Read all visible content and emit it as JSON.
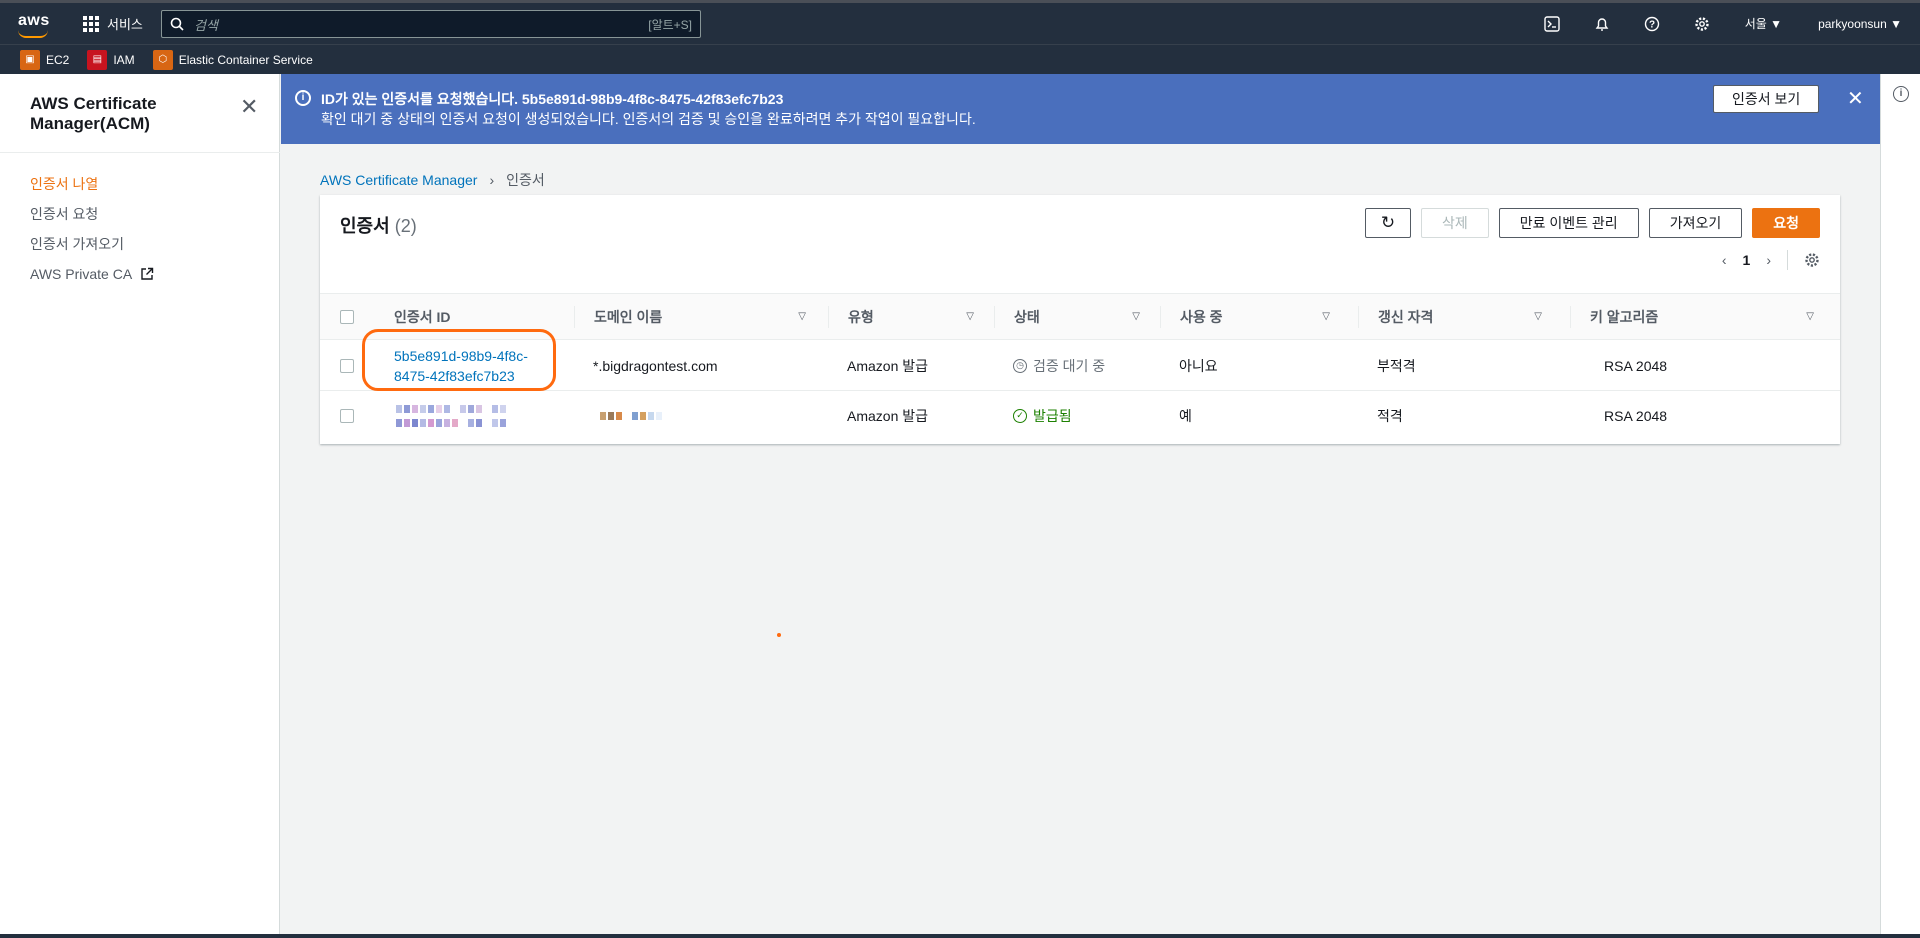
{
  "topnav": {
    "logo": "aws",
    "services_label": "서비스",
    "search_placeholder": "검색",
    "search_shortcut": "[알트+S]",
    "region": "서울 ▼",
    "user": "parkyoonsun ▼",
    "icons": [
      "cloudshell-icon",
      "bell-icon",
      "help-icon",
      "settings-icon"
    ]
  },
  "favorites": [
    {
      "label": "EC2",
      "color": "#d86613"
    },
    {
      "label": "IAM",
      "color": "#c7131f"
    },
    {
      "label": "Elastic Container Service",
      "color": "#d86613"
    }
  ],
  "sidebar": {
    "title": "AWS Certificate Manager(ACM)",
    "items": [
      {
        "label": "인증서 나열",
        "active": true
      },
      {
        "label": "인증서 요청"
      },
      {
        "label": "인증서 가져오기"
      },
      {
        "label": "AWS Private CA",
        "external": true
      }
    ]
  },
  "flash": {
    "title": "ID가 있는 인증서를 요청했습니다. 5b5e891d-98b9-4f8c-8475-42f83efc7b23",
    "message": "확인 대기 중 상태의 인증서 요청이 생성되었습니다. 인증서의 검증 및 승인을 완료하려면 추가 작업이 필요합니다.",
    "button": "인증서 보기"
  },
  "breadcrumb": {
    "root": "AWS Certificate Manager",
    "sep": "›",
    "current": "인증서"
  },
  "panel": {
    "title": "인증서",
    "count": "(2)",
    "buttons": {
      "delete": "삭제",
      "expiry": "만료 이벤트 관리",
      "import": "가져오기",
      "request": "요청"
    },
    "page": "1"
  },
  "table": {
    "headers": [
      "인증서 ID",
      "도메인 이름",
      "유형",
      "상태",
      "사용 중",
      "갱신 자격",
      "키 알고리즘"
    ],
    "rows": [
      {
        "id_line1": "5b5e891d-98b9-4f8c-",
        "id_line2": "8475-42f83efc7b23",
        "domain": "*.bigdragontest.com",
        "type": "Amazon 발급",
        "status": "검증 대기 중",
        "in_use": "아니요",
        "renewal": "부적격",
        "algo": "RSA 2048"
      },
      {
        "id_line1": "",
        "id_line2": "",
        "domain": "",
        "type": "Amazon 발급",
        "status": "발급됨",
        "in_use": "예",
        "renewal": "적격",
        "algo": "RSA 2048"
      }
    ]
  },
  "colors": {
    "accent": "#ec7211",
    "flash": "#4a6fbd",
    "link": "#0073bb",
    "success": "#1d8102"
  }
}
